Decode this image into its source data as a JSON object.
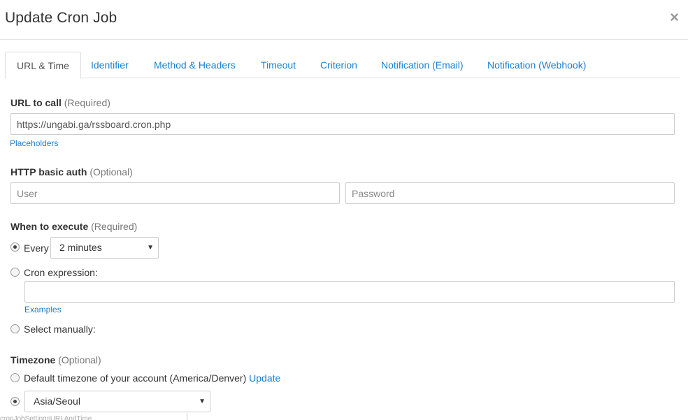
{
  "dialog": {
    "title": "Update Cron Job",
    "close_glyph": "×"
  },
  "tabs": [
    {
      "label": "URL & Time",
      "active": true
    },
    {
      "label": "Identifier"
    },
    {
      "label": "Method & Headers"
    },
    {
      "label": "Timeout"
    },
    {
      "label": "Criterion"
    },
    {
      "label": "Notification (Email)"
    },
    {
      "label": "Notification (Webhook)"
    }
  ],
  "url_section": {
    "label": "URL to call",
    "hint": "(Required)",
    "value": "https://ungabi.ga/rssboard.cron.php",
    "placeholders_link": "Placeholders"
  },
  "auth_section": {
    "label": "HTTP basic auth",
    "hint": "(Optional)",
    "user_placeholder": "User",
    "password_placeholder": "Password"
  },
  "execute_section": {
    "label": "When to execute",
    "hint": "(Required)",
    "every_label": "Every",
    "every_value": "2 minutes",
    "cron_label": "Cron expression:",
    "cron_value": "",
    "examples_link": "Examples",
    "manual_label": "Select manually:",
    "selected_option": "every"
  },
  "timezone_section": {
    "label": "Timezone",
    "hint": "(Optional)",
    "default_label": "Default timezone of your account (America/Denver)",
    "update_link": "Update",
    "custom_value": "Asia/Seoul",
    "selected_option": "custom"
  },
  "footer": {
    "truncated_text": "cronJobSettingsURLAndTime"
  },
  "colors": {
    "link": "#1a7fd1",
    "border": "#cccccc",
    "text": "#333333"
  }
}
